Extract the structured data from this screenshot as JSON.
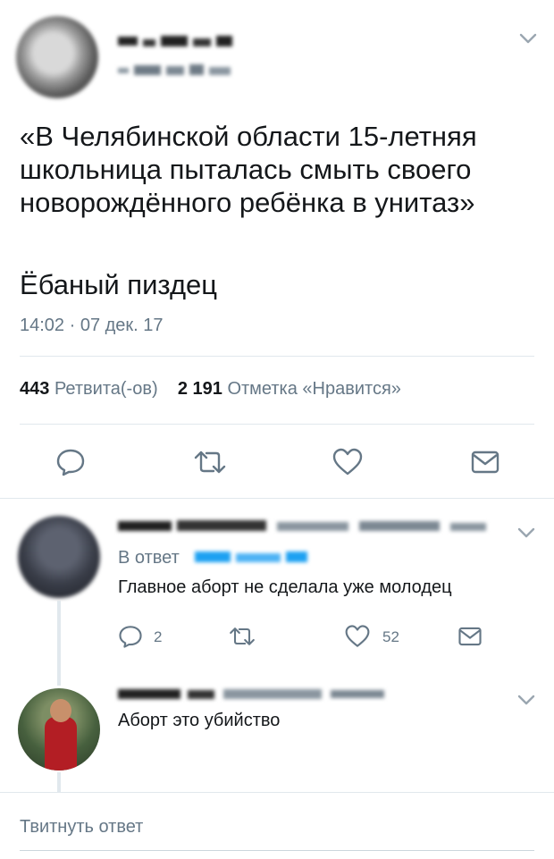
{
  "tweet": {
    "text_line1": "«В Челябинской области 15-летняя",
    "text_line2": "школьница пыталась смыть своего",
    "text_line3": "новорождённого ребёнка в унитаз»",
    "extra": "Ёбаный пиздец",
    "time": "14:02 · 07 дек. 17",
    "retweets_count": "443",
    "retweets_label": "Ретвита(-ов)",
    "likes_count": "2 191",
    "likes_label": "Отметка «Нравится»"
  },
  "icons": {
    "reply": "reply-icon",
    "retweet": "retweet-icon",
    "like": "heart-icon",
    "message": "envelope-icon",
    "more": "chevron-down-icon"
  },
  "replies": [
    {
      "in_reply_prefix": "В ответ",
      "text": "Главное аборт не сделала уже молодец",
      "reply_count": "2",
      "like_count": "52"
    },
    {
      "text": "Аборт это убийство"
    }
  ],
  "compose": {
    "placeholder": "Твитнуть ответ"
  },
  "colors": {
    "muted": "#657786",
    "divider": "#e1e8ed",
    "text": "#14171a"
  }
}
